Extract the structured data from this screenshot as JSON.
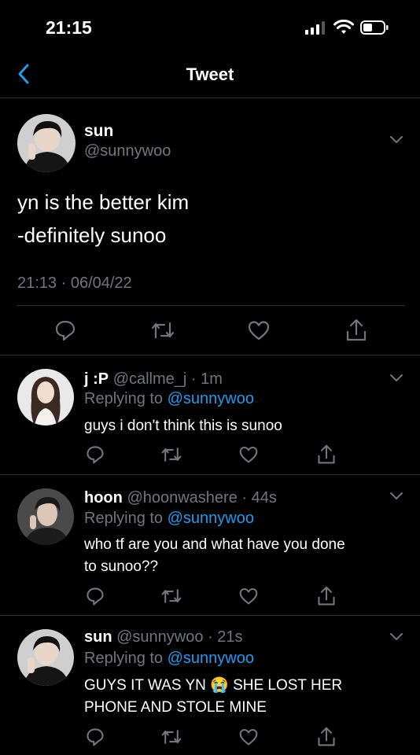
{
  "status": {
    "time": "21:15"
  },
  "header": {
    "title": "Tweet"
  },
  "main_tweet": {
    "name": "sun",
    "handle": "@sunnywoo",
    "text_line1": "yn is the better kim",
    "text_line2": "-definitely sunoo",
    "timestamp": "21:13 · 06/04/22"
  },
  "replies": [
    {
      "name": "j :P",
      "handle": "@callme_j",
      "age": "· 1m",
      "replying_prefix": "Replying to ",
      "replying_handle": "@sunnywoo",
      "text_line1": "guys i don't think this is sunoo",
      "text_line2": ""
    },
    {
      "name": "hoon",
      "handle": "@hoonwashere",
      "age": "· 44s",
      "replying_prefix": "Replying to ",
      "replying_handle": "@sunnywoo",
      "text_line1": "who tf are you and what have you done",
      "text_line2": "to sunoo??"
    },
    {
      "name": "sun",
      "handle": "@sunnywoo",
      "age": "· 21s",
      "replying_prefix": "Replying to ",
      "replying_handle": "@sunnywoo",
      "text_line1": "GUYS IT WAS YN 😭 SHE LOST HER",
      "text_line2": "PHONE AND STOLE MINE"
    }
  ],
  "colors": {
    "accent": "#1d9bf0",
    "muted": "#71767b",
    "divider": "#2f3336"
  },
  "icons": [
    "back-chevron-icon",
    "reply-icon",
    "retweet-icon",
    "like-icon",
    "share-icon",
    "more-chevron-icon"
  ]
}
